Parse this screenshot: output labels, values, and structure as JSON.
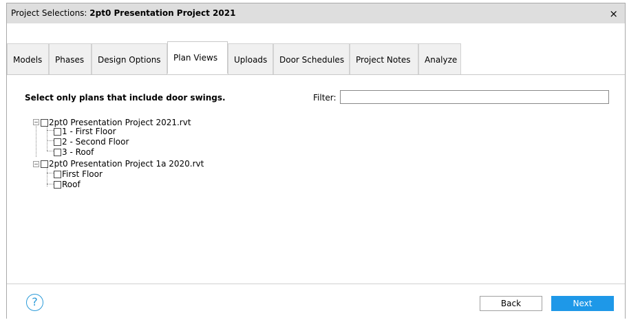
{
  "window": {
    "title_prefix": "Project Selections: ",
    "title_project": "2pt0 Presentation Project 2021",
    "close_glyph": "×"
  },
  "tabs": [
    {
      "label": "Models"
    },
    {
      "label": "Phases"
    },
    {
      "label": "Design Options"
    },
    {
      "label": "Plan Views",
      "active": true
    },
    {
      "label": "Uploads"
    },
    {
      "label": "Door Schedules"
    },
    {
      "label": "Project Notes"
    },
    {
      "label": "Analyze"
    }
  ],
  "plan_views": {
    "instruction": "Select only plans that include door swings.",
    "filter_label": "Filter:",
    "filter_value": "",
    "tree": [
      {
        "label": "2pt0 Presentation Project 2021.rvt",
        "checked": false,
        "expanded": true,
        "children": [
          {
            "label": "1 - First Floor",
            "checked": false
          },
          {
            "label": "2 - Second Floor",
            "checked": false
          },
          {
            "label": "3 - Roof",
            "checked": false
          }
        ]
      },
      {
        "label": "2pt0 Presentation Project 1a 2020.rvt",
        "checked": false,
        "expanded": true,
        "children": [
          {
            "label": "First Floor",
            "checked": false
          },
          {
            "label": "Roof",
            "checked": false
          }
        ]
      }
    ]
  },
  "footer": {
    "help_glyph": "?",
    "back_label": "Back",
    "next_label": "Next"
  },
  "colors": {
    "accent": "#1e98e8",
    "titlebar": "#dedede"
  }
}
